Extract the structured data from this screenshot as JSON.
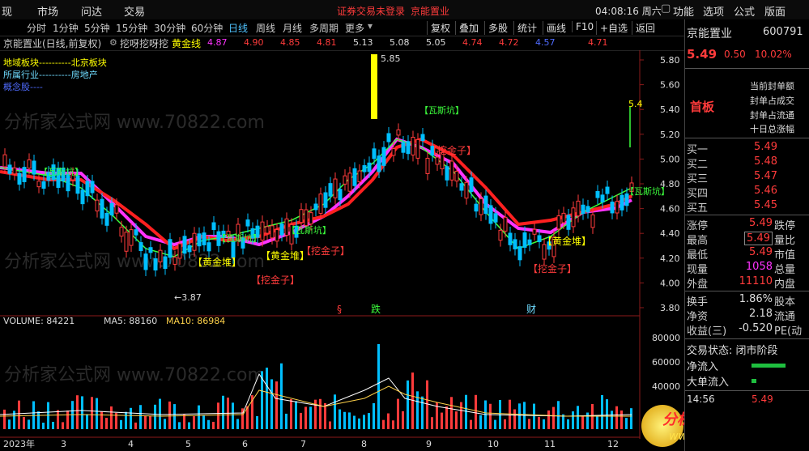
{
  "menu": {
    "left_items": [
      "现",
      "市场",
      "问达",
      "交易"
    ],
    "center_notice": "证券交易未登录",
    "center_stock": "京能置业",
    "clock": "04:08:16 周六",
    "right_items": [
      "功能",
      "选项",
      "公式",
      "版面"
    ]
  },
  "timeframes": [
    "分时",
    "1分钟",
    "5分钟",
    "15分钟",
    "30分钟",
    "60分钟",
    "日线",
    "周线",
    "月线",
    "多周期",
    "更多"
  ],
  "active_timeframe": "日线",
  "toolbar": {
    "buttons": [
      "复权",
      "叠加",
      "多股",
      "统计",
      "画线",
      "F10",
      "+自选",
      "返回"
    ]
  },
  "infobar": {
    "title": "京能置业(日线,前复权)",
    "indicator": "挖呀挖呀挖",
    "gold_label": "黄金线",
    "gold_values": [
      "4.87",
      "4.90",
      "4.85",
      "4.81",
      "5.13",
      "5.08",
      "5.05",
      "4.74",
      "4.72",
      "4.57",
      "4.71"
    ]
  },
  "overlay_text": {
    "block_label": "地域板块----------北京板块",
    "industry_label": "所属行业----------房地产",
    "concept_label": "概念股----"
  },
  "annotations": {
    "wasikeng": "【瓦斯坑】",
    "huangjindui": "【黄金堆】",
    "wajinzi": "【挖金子】",
    "high_label": "5.85",
    "low_label": "3.87",
    "right_tag": "5.4",
    "event_jiang": "跌",
    "event_cai": "财",
    "event_s": "§"
  },
  "price_axis": [
    "5.80",
    "5.60",
    "5.40",
    "5.20",
    "5.00",
    "4.80",
    "4.60",
    "4.40",
    "4.20",
    "4.00",
    "3.80"
  ],
  "volume_bar": {
    "volume_label": "VOLUME: 84221",
    "ma5_label": "MA5: 88160",
    "ma10_label": "MA10: 86984"
  },
  "volume_axis": [
    "80000",
    "60000",
    "40000"
  ],
  "time_axis": [
    "2023年",
    "3",
    "4",
    "5",
    "6",
    "7",
    "8",
    "9",
    "10",
    "11",
    "12"
  ],
  "watermark": "分析家公式网 www.70822.com",
  "logo": {
    "name": "分析家公式网",
    "url": "www.fxjgsw.com"
  },
  "quote": {
    "name": "京能置业",
    "code": "600791",
    "price": "5.49",
    "change": "0.50",
    "change_pct": "10.02%",
    "status_label": "首板",
    "seal_lines": [
      "当前封单额",
      "封单占成交",
      "封单占流通",
      "十日总涨幅"
    ],
    "bids": [
      {
        "label": "买一",
        "price": "5.49"
      },
      {
        "label": "买二",
        "price": "5.48"
      },
      {
        "label": "买三",
        "price": "5.47"
      },
      {
        "label": "买四",
        "price": "5.46"
      },
      {
        "label": "买五",
        "price": "5.45"
      }
    ],
    "stats": [
      {
        "label": "涨停",
        "value": "5.49",
        "sub": "跌停"
      },
      {
        "label": "最高",
        "value": "5.49",
        "sub": "量比"
      },
      {
        "label": "最低",
        "value": "5.49",
        "sub": "市值"
      },
      {
        "label": "现量",
        "value": "1058",
        "sub": "总量"
      },
      {
        "label": "外盘",
        "value": "11110",
        "sub": "内盘"
      }
    ],
    "fin": [
      {
        "label": "换手",
        "value": "1.86%",
        "sub": "股本"
      },
      {
        "label": "净资",
        "value": "2.18",
        "sub": "流通"
      },
      {
        "label": "收益(三)",
        "value": "-0.520",
        "sub": "PE(动"
      }
    ],
    "trade_state": "交易状态: 闭市阶段",
    "net_in": "净流入",
    "big_in": "大单流入",
    "tick_time": "14:56",
    "tick_price": "5.49"
  },
  "colors": {
    "up": "#ff3b3b",
    "down": "#00bfff",
    "gold": "#ffff00",
    "magenta": "#ff33ff"
  }
}
